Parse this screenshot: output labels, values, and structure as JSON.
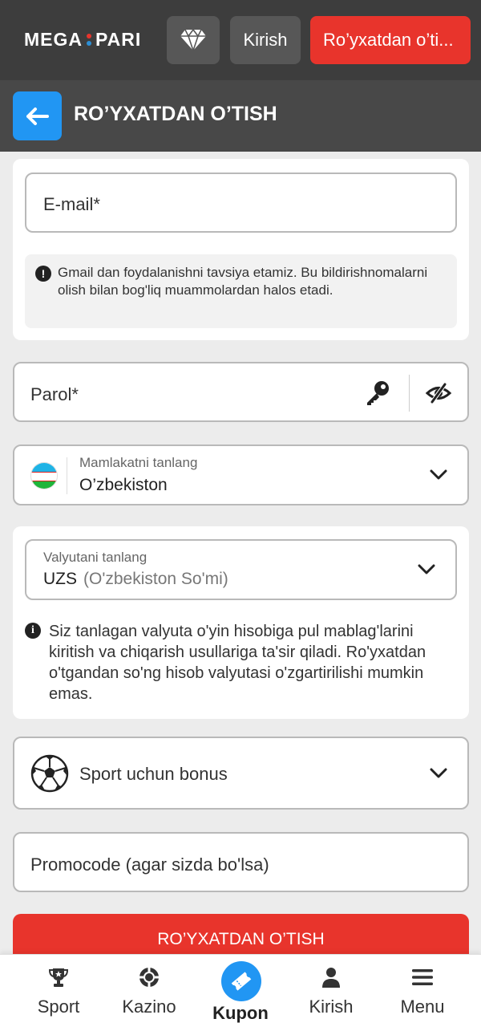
{
  "header": {
    "logo_left": "MEGA",
    "logo_right": "PARI",
    "login_label": "Kirish",
    "register_label": "Ro’yxatdan o’ti..."
  },
  "page": {
    "title": "RO’YXATDAN O’TISH"
  },
  "form": {
    "email_placeholder": "E-mail*",
    "email_note": "Gmail dan foydalanishni tavsiya etamiz. Bu bildirishnomalarni olish bilan bog'liq muammolardan halos etadi.",
    "password_placeholder": "Parol*",
    "country_label": "Mamlakatni tanlang",
    "country_value": "O’zbekiston",
    "currency_label": "Valyutani tanlang",
    "currency_code": "UZS",
    "currency_name": "(O'zbekiston So'mi)",
    "currency_note": "Siz tanlagan valyuta o'yin hisobiga pul mablag'larini kiritish va chiqarish usullariga ta'sir qiladi. Ro'yxatdan o'tgandan so'ng hisob valyutasi o'zgartirilishi mumkin emas.",
    "bonus_label": "Sport uchun bonus",
    "promo_placeholder": "Promocode (agar sizda bo'lsa)",
    "submit_label": "RO’YXATDAN O’TISH"
  },
  "nav": {
    "sport": "Sport",
    "kazino": "Kazino",
    "kupon": "Kupon",
    "kirish": "Kirish",
    "menu": "Menu"
  },
  "colors": {
    "accent_red": "#e8342c",
    "accent_blue": "#2196f3",
    "header_bg": "#3d3d3d"
  }
}
